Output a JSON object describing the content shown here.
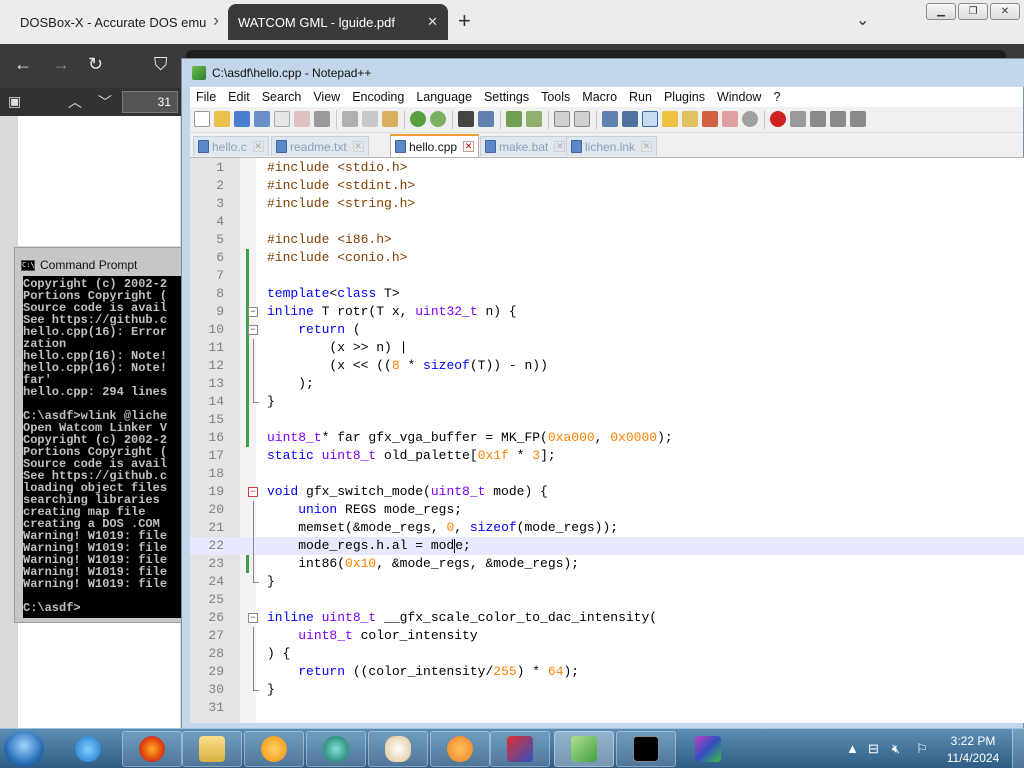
{
  "browser": {
    "tabs": [
      {
        "title": "DOSBox-X - Accurate DOS emu",
        "close": "✕"
      },
      {
        "title": "WATCOM GML - lguide.pdf",
        "close": "✕"
      }
    ],
    "new_tab": "+",
    "tab_menu": "⌄",
    "pdf_page_number": "31"
  },
  "cmd": {
    "title": "Command Prompt",
    "lines": [
      "Copyright (c) 2002-2",
      "Portions Copyright (",
      "Source code is avail",
      "See https://github.c",
      "hello.cpp(16): Error",
      "zation",
      "hello.cpp(16): Note!",
      "hello.cpp(16): Note!",
      "far'",
      "hello.cpp: 294 lines",
      "",
      "C:\\asdf>wlink @liche",
      "Open Watcom Linker V",
      "Copyright (c) 2002-2",
      "Portions Copyright (",
      "Source code is avail",
      "See https://github.c",
      "loading object files",
      "searching libraries",
      "creating map file",
      "creating a DOS .COM",
      "Warning! W1019: file",
      "Warning! W1019: file",
      "Warning! W1019: file",
      "Warning! W1019: file",
      "Warning! W1019: file",
      "",
      "C:\\asdf>"
    ]
  },
  "npp": {
    "title": "C:\\asdf\\hello.cpp - Notepad++",
    "menu": [
      "File",
      "Edit",
      "Search",
      "View",
      "Encoding",
      "Language",
      "Settings",
      "Tools",
      "Macro",
      "Run",
      "Plugins",
      "Window",
      "?"
    ],
    "tabs": [
      {
        "name": "hello.c",
        "active": false
      },
      {
        "name": "readme.txt",
        "active": false
      },
      {
        "name": "hello.cpp",
        "active": true
      },
      {
        "name": "make.bat",
        "active": false
      },
      {
        "name": "lichen.lnk",
        "active": false
      }
    ],
    "tab_close": "✕",
    "current_line": 22,
    "code": [
      {
        "n": "1",
        "html": "<span class=\"pp\">#include &lt;stdio.h&gt;</span>"
      },
      {
        "n": "2",
        "html": "<span class=\"pp\">#include &lt;stdint.h&gt;</span>"
      },
      {
        "n": "3",
        "html": "<span class=\"pp\">#include &lt;string.h&gt;</span>"
      },
      {
        "n": "4",
        "html": ""
      },
      {
        "n": "5",
        "html": "<span class=\"pp\">#include &lt;i86.h&gt;</span>"
      },
      {
        "n": "6",
        "html": "<span class=\"pp\">#include &lt;conio.h&gt;</span>"
      },
      {
        "n": "7",
        "html": ""
      },
      {
        "n": "8",
        "html": "<span class=\"k\">template</span>&lt;<span class=\"k\">class</span> T&gt;"
      },
      {
        "n": "9",
        "html": "<span class=\"k\">inline</span> T rotr(T x, <span class=\"t\">uint32_t</span> n) {"
      },
      {
        "n": "10",
        "html": "    <span class=\"k\">return</span> ("
      },
      {
        "n": "11",
        "html": "        (x &gt;&gt; n) |"
      },
      {
        "n": "12",
        "html": "        (x &lt;&lt; ((<span class=\"n\">8</span> * <span class=\"k\">sizeof</span>(T)) - n))"
      },
      {
        "n": "13",
        "html": "    );"
      },
      {
        "n": "14",
        "html": "}"
      },
      {
        "n": "15",
        "html": ""
      },
      {
        "n": "16",
        "html": "<span class=\"t\">uint8_t</span>* far gfx_vga_buffer = MK_FP(<span class=\"n\">0xa000</span>, <span class=\"n\">0x0000</span>);"
      },
      {
        "n": "17",
        "html": "<span class=\"k\">static</span> <span class=\"t\">uint8_t</span> old_palette[<span class=\"n\">0x1f</span> * <span class=\"n\">3</span>];"
      },
      {
        "n": "18",
        "html": ""
      },
      {
        "n": "19",
        "html": "<span class=\"k\">void</span> gfx_switch_mode(<span class=\"t\">uint8_t</span> mode) {"
      },
      {
        "n": "20",
        "html": "    <span class=\"k\">union</span> REGS mode_regs;"
      },
      {
        "n": "21",
        "html": "    memset(&amp;mode_regs, <span class=\"n\">0</span>, <span class=\"k\">sizeof</span>(mode_regs));"
      },
      {
        "n": "22",
        "html": "    mode_regs.h.al = mod<span class=\"caret\"></span>e;"
      },
      {
        "n": "23",
        "html": "    int86(<span class=\"n\">0x10</span>, &amp;mode_regs, &amp;mode_regs);"
      },
      {
        "n": "24",
        "html": "}"
      },
      {
        "n": "25",
        "html": ""
      },
      {
        "n": "26",
        "html": "<span class=\"k\">inline</span> <span class=\"t\">uint8_t</span> __gfx_scale_color_to_dac_intensity("
      },
      {
        "n": "27",
        "html": "    <span class=\"t\">uint8_t</span> color_intensity"
      },
      {
        "n": "28",
        "html": ") {"
      },
      {
        "n": "29",
        "html": "    <span class=\"k\">return</span> ((color_intensity/<span class=\"n\">255</span>) * <span class=\"n\">64</span>);"
      },
      {
        "n": "30",
        "html": "}"
      },
      {
        "n": "31",
        "html": ""
      }
    ]
  },
  "taskbar": {
    "time": "3:22 PM",
    "date": "11/4/2024"
  }
}
